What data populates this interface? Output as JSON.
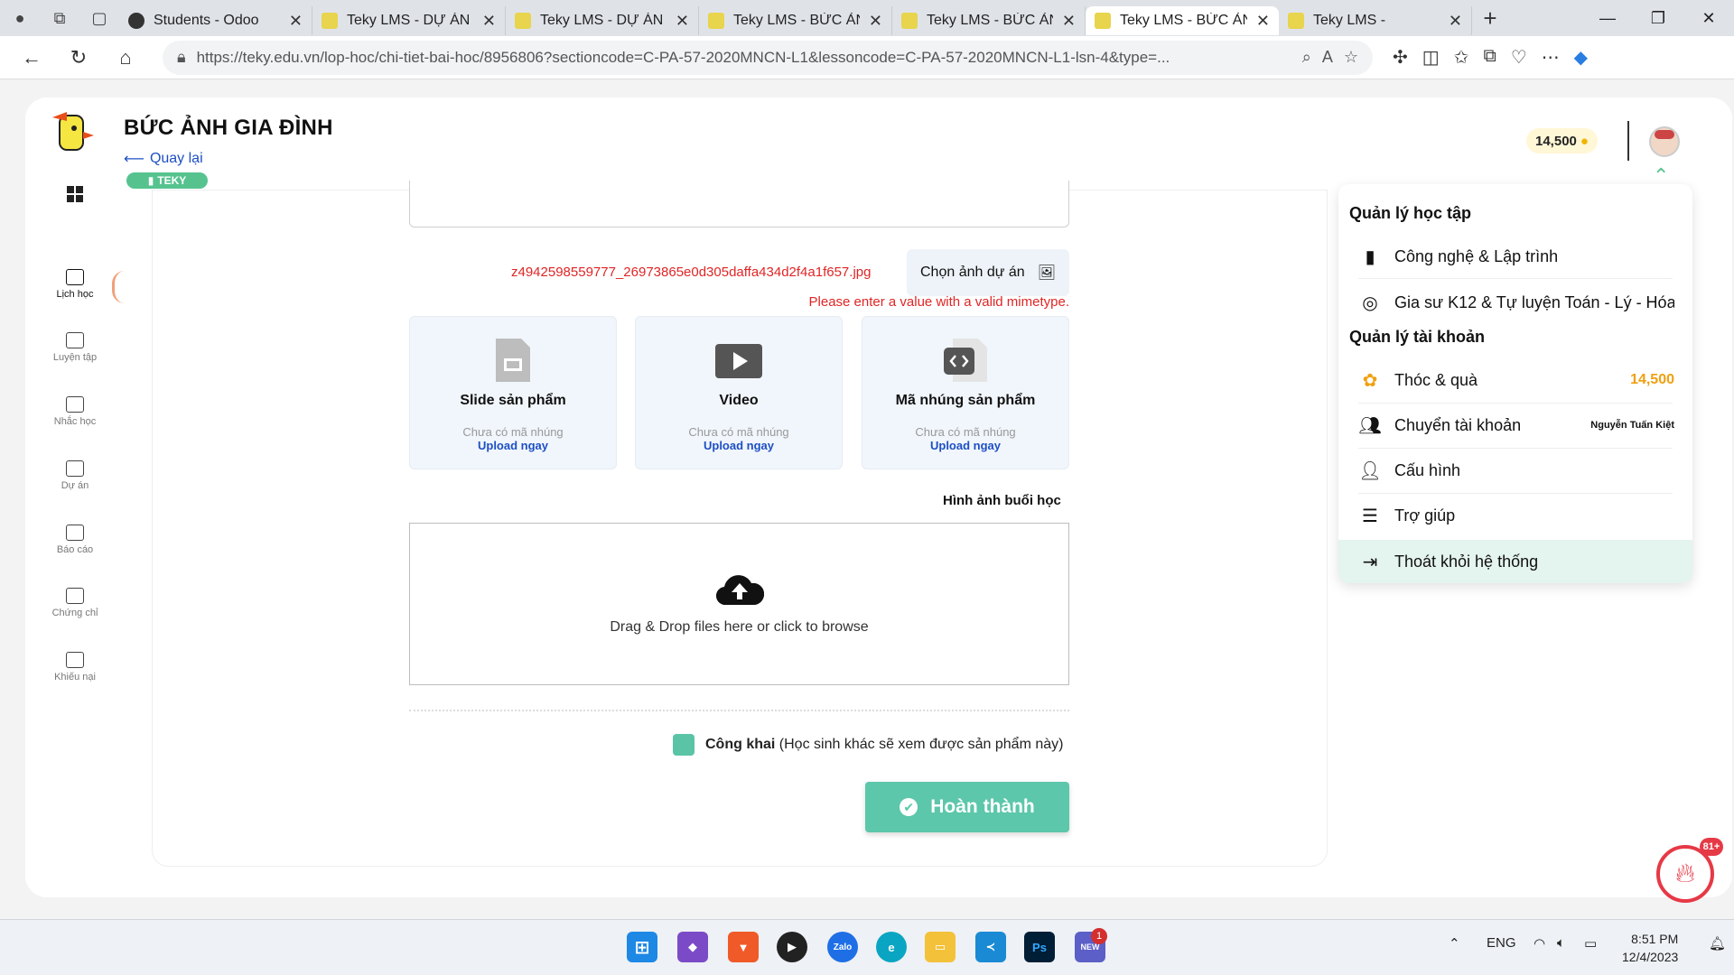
{
  "browser": {
    "tabs": [
      {
        "title": "Students - Odoo",
        "active": false
      },
      {
        "title": "Teky LMS - DỰ ÁN L",
        "active": false
      },
      {
        "title": "Teky LMS - DỰ ÁN L",
        "active": false
      },
      {
        "title": "Teky LMS - BỨC ẢNH",
        "active": false
      },
      {
        "title": "Teky LMS - BỨC ẢNH",
        "active": false
      },
      {
        "title": "Teky LMS - BỨC ẢNH",
        "active": true
      },
      {
        "title": "Teky LMS -",
        "active": false
      }
    ],
    "url": "https://teky.edu.vn/lop-hoc/chi-tiet-bai-hoc/8956806?sectioncode=C-PA-57-2020MNCN-L1&lessoncode=C-PA-57-2020MNCN-L1-lsn-4&type=..."
  },
  "header": {
    "title": "BỨC ẢNH GIA ĐÌNH",
    "back_label": "Quay lại",
    "badge": "TEKY",
    "coins": "14,500"
  },
  "sidebar": {
    "items": [
      {
        "label": "Lịch học"
      },
      {
        "label": "Luyện tập"
      },
      {
        "label": "Nhắc học"
      },
      {
        "label": "Dự án"
      },
      {
        "label": "Báo cáo"
      },
      {
        "label": "Chứng chỉ"
      },
      {
        "label": "Khiếu nại"
      }
    ]
  },
  "form": {
    "filename": "z4942598559777_26973865e0d305daffa434d2f4a1f657.jpg",
    "choose_label": "Chọn ảnh dự án",
    "error": "Please enter a value with a valid mimetype.",
    "cards": [
      {
        "title": "Slide sản phẩm",
        "sub": "Chưa có mã nhúng",
        "link": "Upload ngay"
      },
      {
        "title": "Video",
        "sub": "Chưa có mã nhúng",
        "link": "Upload ngay"
      },
      {
        "title": "Mã nhúng sản phẩm",
        "sub": "Chưa có mã nhúng",
        "link": "Upload ngay"
      }
    ],
    "images_label": "Hình ảnh buổi học",
    "dropzone_text": "Drag & Drop files here or click to browse",
    "public_label": "Công khai",
    "public_hint": "(Học sinh khác sẽ xem được sản phẩm này)",
    "finish_label": "Hoàn thành"
  },
  "dropdown": {
    "learning_heading": "Quản lý học tập",
    "learning_items": [
      {
        "label": "Công nghệ & Lập trình"
      },
      {
        "label": "Gia sư K12 & Tự luyện Toán - Lý - Hóa..."
      }
    ],
    "account_heading": "Quản lý tài khoản",
    "account_items": [
      {
        "label": "Thóc & quà",
        "value": "14,500"
      },
      {
        "label": "Chuyển tài khoản",
        "value": "Nguyễn Tuấn Kiệt"
      },
      {
        "label": "Cấu hình",
        "value": ""
      },
      {
        "label": "Trợ giúp",
        "value": ""
      },
      {
        "label": "Thoát khỏi hệ thống",
        "value": ""
      }
    ]
  },
  "fire_badge": "81+",
  "taskbar": {
    "lang": "ENG",
    "time": "8:51 PM",
    "date": "12/4/2023",
    "notif": "1",
    "zalo": "Zalo",
    "ps": "Ps",
    "new": "NEW"
  }
}
